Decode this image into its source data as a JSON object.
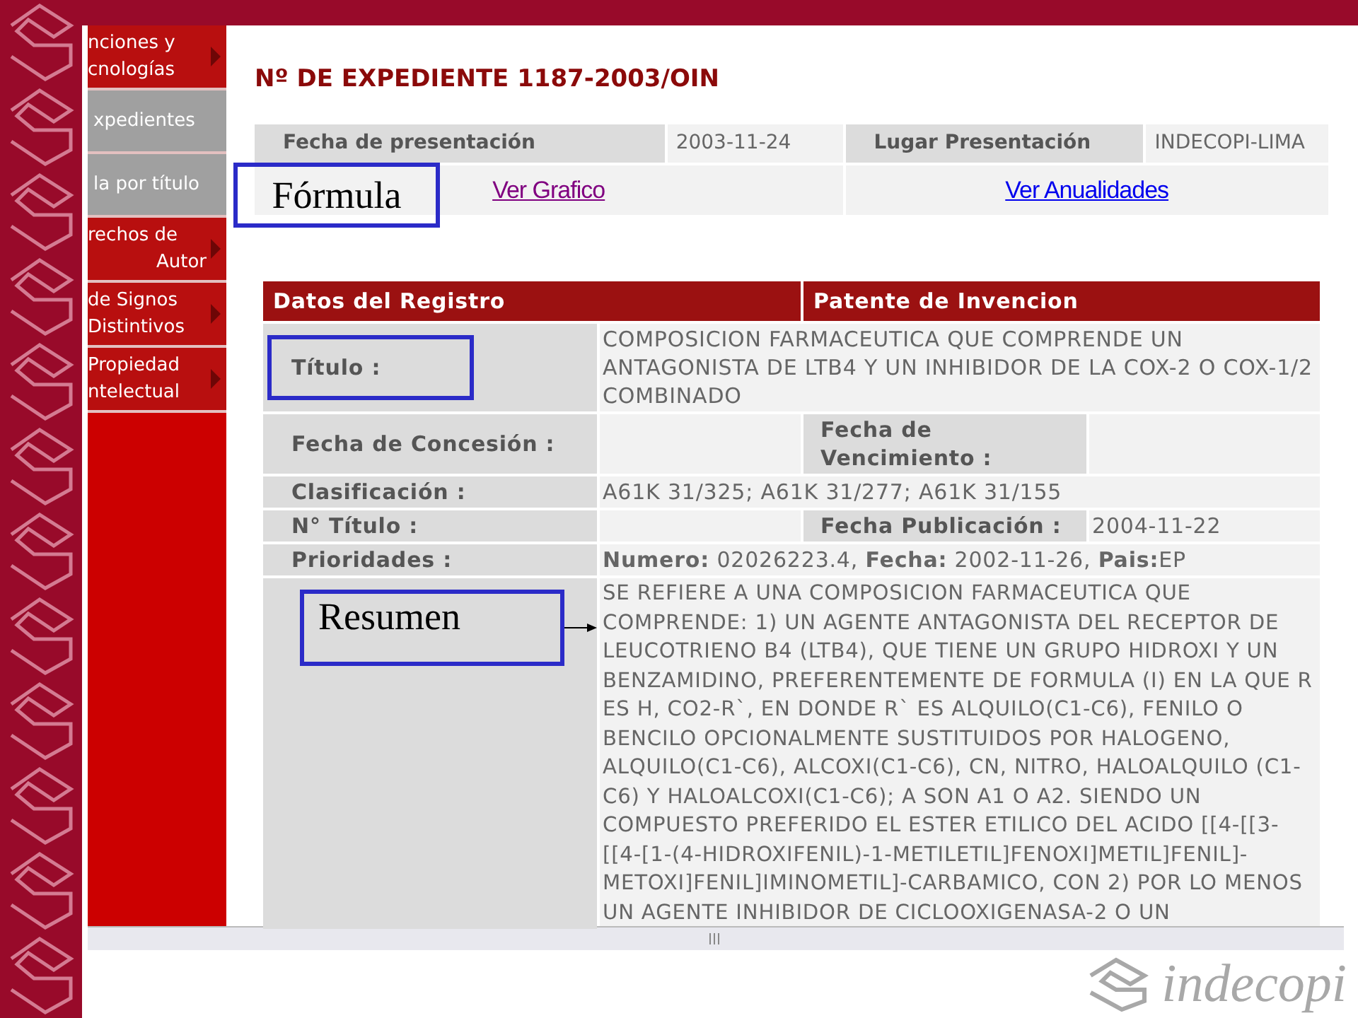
{
  "sidebar": {
    "items": [
      {
        "lines": [
          "nciones y",
          "cnologías"
        ],
        "kind": "section",
        "arrow": true
      },
      {
        "lines": [
          "xpedientes"
        ],
        "kind": "link",
        "arrow": false
      },
      {
        "lines": [
          "la por título"
        ],
        "kind": "link",
        "arrow": false
      },
      {
        "lines": [
          "rechos de",
          "Autor"
        ],
        "kind": "section",
        "arrow": true
      },
      {
        "lines": [
          "de Signos",
          "Distintivos"
        ],
        "kind": "section",
        "arrow": true
      },
      {
        "lines": [
          "Propiedad",
          "ntelectual"
        ],
        "kind": "section",
        "arrow": true
      }
    ]
  },
  "title": "Nº DE EXPEDIENTE 1187-2003/OIN",
  "filing": {
    "fields": [
      {
        "label": "Fecha de presentación",
        "value": "2003-11-24"
      },
      {
        "label": "Lugar Presentación",
        "value": "INDECOPI-LIMA"
      }
    ],
    "links": [
      {
        "text": "Ver Grafico",
        "visited": true,
        "callout": "Fórmula"
      },
      {
        "text": "Ver Anualidades",
        "visited": false
      }
    ]
  },
  "registro": {
    "header": [
      "Datos del Registro",
      "Patente de Invencion"
    ],
    "fields": [
      {
        "label": "Título :",
        "highlighted": true,
        "value": "COMPOSICION FARMACEUTICA QUE COMPRENDE UN ANTAGONISTA DE LTB4 Y UN INHIBIDOR DE LA COX-2 O COX-1/2 COMBINADO"
      },
      {
        "label": "Fecha de Concesión :",
        "extra": {
          "label": "Fecha de Vencimiento :"
        }
      },
      {
        "label": "Clasificación :",
        "value": "A61K 31/325; A61K 31/277; A61K 31/155"
      },
      {
        "label": "N° Título :",
        "extra": {
          "label": "Fecha Publicación :",
          "value": "2004-11-22"
        }
      },
      {
        "label": "Prioridades :",
        "value": "**Numero:** 02026223.4,  **Fecha:** 2002-11-26,   **Pais:**EP"
      },
      {
        "callout": "Resumen",
        "arrow": true,
        "value": "SE REFIERE A UNA COMPOSICION FARMACEUTICA QUE COMPRENDE: 1) UN AGENTE ANTAGONISTA DEL RECEPTOR DE LEUCOTRIENO B4 (LTB4), QUE TIENE UN GRUPO HIDROXI Y UN BENZAMIDINO, PREFERENTEMENTE DE FORMULA (I) EN LA QUE R ES H, CO2-R`, EN DONDE R` ES ALQUILO(C1-C6), FENILO O BENCILO OPCIONALMENTE SUSTITUIDOS POR HALOGENO, ALQUILO(C1-C6), ALCOXI(C1-C6), CN, NITRO, HALOALQUILO (C1-C6) Y HALOALCOXI(C1-C6); A SON A1 O A2. SIENDO UN COMPUESTO PREFERIDO EL ESTER ETILICO DEL ACIDO [[4-[[3-[[4-[1-(4-HIDROXIFENIL)-1-METILETIL]FENOXI]METIL]FENIL]-METOXI]FENIL]IMINOMETIL]-CARBAMICO, CON 2) POR LO MENOS UN AGENTE INHIBIDOR DE CICLOOXIGENASA-2 O UN"
      }
    ]
  },
  "logo": {
    "text": "indecopi"
  }
}
